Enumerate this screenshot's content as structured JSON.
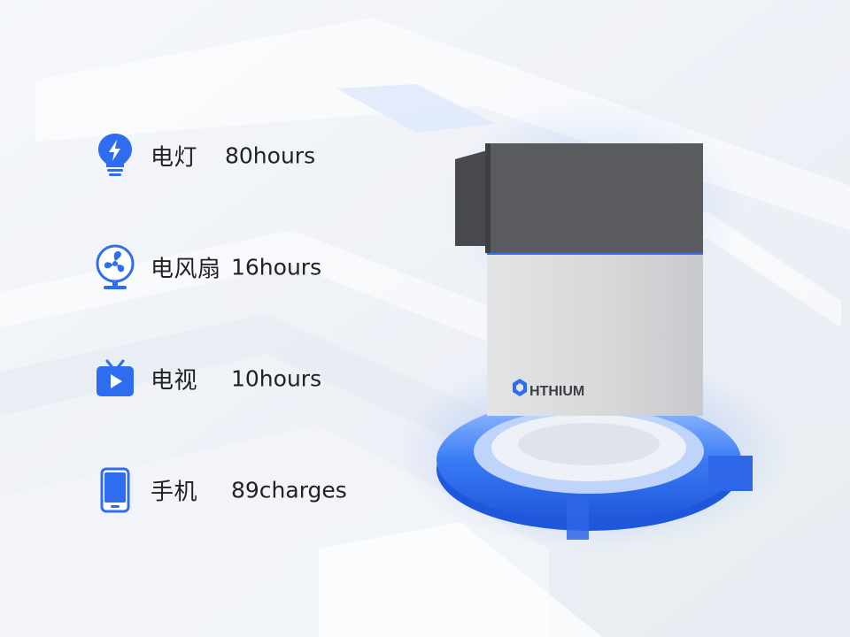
{
  "appliances": [
    {
      "icon": "lightbulb-icon",
      "label": "电灯",
      "value": "80hours"
    },
    {
      "icon": "fan-icon",
      "label": "电风扇",
      "value": "16hours"
    },
    {
      "icon": "tv-icon",
      "label": "电视",
      "value": "10hours"
    },
    {
      "icon": "phone-icon",
      "label": "手机",
      "value": "89charges"
    }
  ],
  "product": {
    "brand": "HTHIUM"
  },
  "colors": {
    "accent": "#2f6df0",
    "dark": "#5a5b5e",
    "body": "#d9dadc",
    "text": "#222222"
  }
}
